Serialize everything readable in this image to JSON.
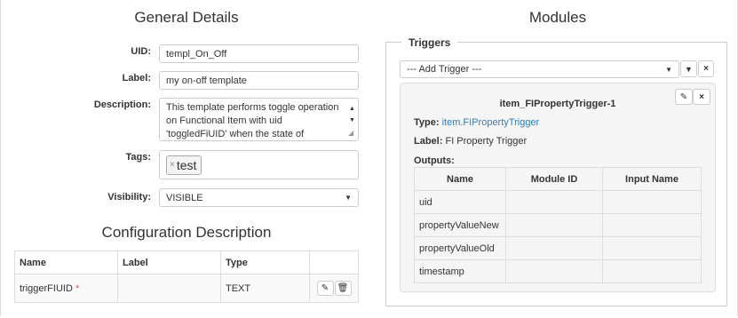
{
  "general": {
    "title": "General Details",
    "uid_label": "UID:",
    "uid_value": "templ_On_Off",
    "label_label": "Label:",
    "label_value": "my on-off template",
    "description_label": "Description:",
    "description_value": "This template performs toggle operation on Functional Item with uid 'toggledFiUID' when the state of",
    "tags_label": "Tags:",
    "tag_remove": "×",
    "tag_value": "test",
    "visibility_label": "Visibility:",
    "visibility_value": "VISIBLE"
  },
  "config": {
    "title": "Configuration Description",
    "headers": [
      "Name",
      "Label",
      "Type"
    ],
    "rows": [
      {
        "name": "triggerFIUID",
        "required_mark": "*",
        "label": "",
        "type": "TEXT"
      }
    ]
  },
  "modules": {
    "title": "Modules",
    "triggers_legend": "Triggers",
    "add_trigger": "--- Add Trigger ---",
    "trigger": {
      "title": "item_FIPropertyTrigger-1",
      "type_label": "Type:",
      "type_value": "item.FIPropertyTrigger",
      "label_label": "Label:",
      "label_value": "FI Property Trigger",
      "outputs_label": "Outputs:",
      "headers": [
        "Name",
        "Module ID",
        "Input Name"
      ],
      "rows": [
        {
          "name": "uid",
          "module_id": "",
          "input_name": ""
        },
        {
          "name": "propertyValueNew",
          "module_id": "",
          "input_name": ""
        },
        {
          "name": "propertyValueOld",
          "module_id": "",
          "input_name": ""
        },
        {
          "name": "timestamp",
          "module_id": "",
          "input_name": ""
        }
      ]
    }
  },
  "colors": {
    "link": "#337ab7",
    "required": "#d9534f"
  }
}
